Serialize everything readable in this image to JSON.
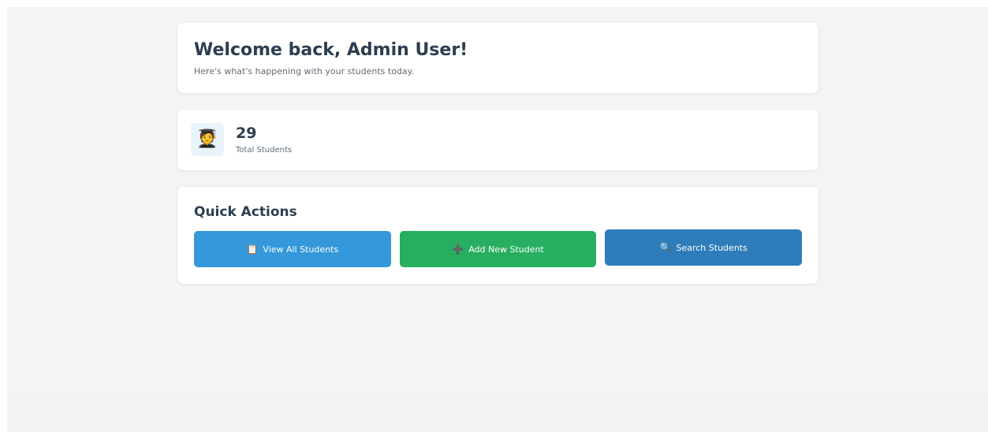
{
  "welcome": {
    "title": "Welcome back, Admin User!",
    "subtitle": "Here's what's happening with your students today."
  },
  "stats": {
    "icon": "graduate-student-icon",
    "icon_glyph": "🧑‍🎓",
    "value": "29",
    "label": "Total Students"
  },
  "quick_actions": {
    "title": "Quick Actions",
    "buttons": [
      {
        "label": "View All Students",
        "icon": "clipboard-icon",
        "glyph": "📋",
        "color": "#3498db"
      },
      {
        "label": "Add New Student",
        "icon": "plus-icon",
        "glyph": "➕",
        "color": "#27ae60"
      },
      {
        "label": "Search Students",
        "icon": "magnifier-icon",
        "glyph": "🔍",
        "color": "#2e7dba"
      }
    ]
  },
  "colors": {
    "text_primary": "#2c3e50",
    "text_muted": "#5f6b76",
    "background": "#f4f4f4",
    "card": "#ffffff"
  }
}
